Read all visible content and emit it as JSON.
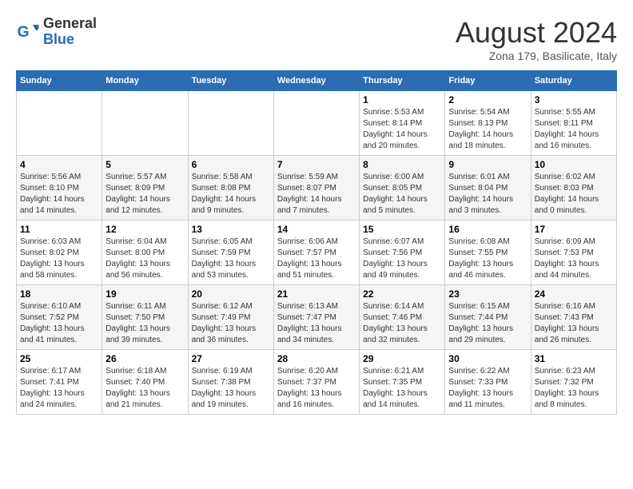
{
  "logo": {
    "general": "General",
    "blue": "Blue"
  },
  "title": "August 2024",
  "subtitle": "Zona 179, Basilicate, Italy",
  "days_of_week": [
    "Sunday",
    "Monday",
    "Tuesday",
    "Wednesday",
    "Thursday",
    "Friday",
    "Saturday"
  ],
  "weeks": [
    [
      {
        "day": "",
        "info": ""
      },
      {
        "day": "",
        "info": ""
      },
      {
        "day": "",
        "info": ""
      },
      {
        "day": "",
        "info": ""
      },
      {
        "day": "1",
        "info": "Sunrise: 5:53 AM\nSunset: 8:14 PM\nDaylight: 14 hours\nand 20 minutes."
      },
      {
        "day": "2",
        "info": "Sunrise: 5:54 AM\nSunset: 8:13 PM\nDaylight: 14 hours\nand 18 minutes."
      },
      {
        "day": "3",
        "info": "Sunrise: 5:55 AM\nSunset: 8:11 PM\nDaylight: 14 hours\nand 16 minutes."
      }
    ],
    [
      {
        "day": "4",
        "info": "Sunrise: 5:56 AM\nSunset: 8:10 PM\nDaylight: 14 hours\nand 14 minutes."
      },
      {
        "day": "5",
        "info": "Sunrise: 5:57 AM\nSunset: 8:09 PM\nDaylight: 14 hours\nand 12 minutes."
      },
      {
        "day": "6",
        "info": "Sunrise: 5:58 AM\nSunset: 8:08 PM\nDaylight: 14 hours\nand 9 minutes."
      },
      {
        "day": "7",
        "info": "Sunrise: 5:59 AM\nSunset: 8:07 PM\nDaylight: 14 hours\nand 7 minutes."
      },
      {
        "day": "8",
        "info": "Sunrise: 6:00 AM\nSunset: 8:05 PM\nDaylight: 14 hours\nand 5 minutes."
      },
      {
        "day": "9",
        "info": "Sunrise: 6:01 AM\nSunset: 8:04 PM\nDaylight: 14 hours\nand 3 minutes."
      },
      {
        "day": "10",
        "info": "Sunrise: 6:02 AM\nSunset: 8:03 PM\nDaylight: 14 hours\nand 0 minutes."
      }
    ],
    [
      {
        "day": "11",
        "info": "Sunrise: 6:03 AM\nSunset: 8:02 PM\nDaylight: 13 hours\nand 58 minutes."
      },
      {
        "day": "12",
        "info": "Sunrise: 6:04 AM\nSunset: 8:00 PM\nDaylight: 13 hours\nand 56 minutes."
      },
      {
        "day": "13",
        "info": "Sunrise: 6:05 AM\nSunset: 7:59 PM\nDaylight: 13 hours\nand 53 minutes."
      },
      {
        "day": "14",
        "info": "Sunrise: 6:06 AM\nSunset: 7:57 PM\nDaylight: 13 hours\nand 51 minutes."
      },
      {
        "day": "15",
        "info": "Sunrise: 6:07 AM\nSunset: 7:56 PM\nDaylight: 13 hours\nand 49 minutes."
      },
      {
        "day": "16",
        "info": "Sunrise: 6:08 AM\nSunset: 7:55 PM\nDaylight: 13 hours\nand 46 minutes."
      },
      {
        "day": "17",
        "info": "Sunrise: 6:09 AM\nSunset: 7:53 PM\nDaylight: 13 hours\nand 44 minutes."
      }
    ],
    [
      {
        "day": "18",
        "info": "Sunrise: 6:10 AM\nSunset: 7:52 PM\nDaylight: 13 hours\nand 41 minutes."
      },
      {
        "day": "19",
        "info": "Sunrise: 6:11 AM\nSunset: 7:50 PM\nDaylight: 13 hours\nand 39 minutes."
      },
      {
        "day": "20",
        "info": "Sunrise: 6:12 AM\nSunset: 7:49 PM\nDaylight: 13 hours\nand 36 minutes."
      },
      {
        "day": "21",
        "info": "Sunrise: 6:13 AM\nSunset: 7:47 PM\nDaylight: 13 hours\nand 34 minutes."
      },
      {
        "day": "22",
        "info": "Sunrise: 6:14 AM\nSunset: 7:46 PM\nDaylight: 13 hours\nand 32 minutes."
      },
      {
        "day": "23",
        "info": "Sunrise: 6:15 AM\nSunset: 7:44 PM\nDaylight: 13 hours\nand 29 minutes."
      },
      {
        "day": "24",
        "info": "Sunrise: 6:16 AM\nSunset: 7:43 PM\nDaylight: 13 hours\nand 26 minutes."
      }
    ],
    [
      {
        "day": "25",
        "info": "Sunrise: 6:17 AM\nSunset: 7:41 PM\nDaylight: 13 hours\nand 24 minutes."
      },
      {
        "day": "26",
        "info": "Sunrise: 6:18 AM\nSunset: 7:40 PM\nDaylight: 13 hours\nand 21 minutes."
      },
      {
        "day": "27",
        "info": "Sunrise: 6:19 AM\nSunset: 7:38 PM\nDaylight: 13 hours\nand 19 minutes."
      },
      {
        "day": "28",
        "info": "Sunrise: 6:20 AM\nSunset: 7:37 PM\nDaylight: 13 hours\nand 16 minutes."
      },
      {
        "day": "29",
        "info": "Sunrise: 6:21 AM\nSunset: 7:35 PM\nDaylight: 13 hours\nand 14 minutes."
      },
      {
        "day": "30",
        "info": "Sunrise: 6:22 AM\nSunset: 7:33 PM\nDaylight: 13 hours\nand 11 minutes."
      },
      {
        "day": "31",
        "info": "Sunrise: 6:23 AM\nSunset: 7:32 PM\nDaylight: 13 hours\nand 8 minutes."
      }
    ]
  ]
}
